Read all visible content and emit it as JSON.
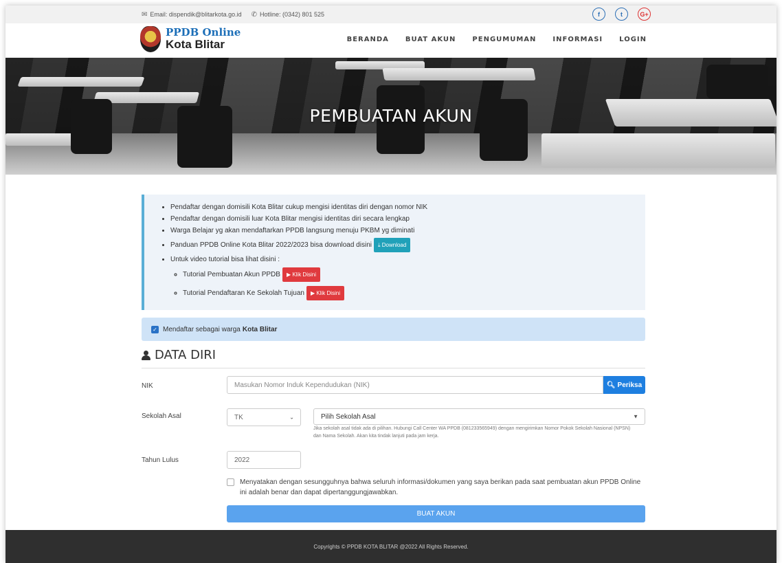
{
  "topbar": {
    "email": "Email: dispendik@blitarkota.go.id",
    "hotline": "Hotline: (0342) 801 525",
    "social": {
      "facebook": "f",
      "twitter": "t",
      "gplus": "G+"
    }
  },
  "brand": {
    "line1": "PPDB Online",
    "line2": "Kota Blitar"
  },
  "nav": {
    "beranda": "BERANDA",
    "buat_akun": "BUAT AKUN",
    "pengumuman": "PENGUMUMAN",
    "informasi": "INFORMASI",
    "login": "LOGIN"
  },
  "hero": {
    "title": "PEMBUATAN AKUN"
  },
  "info": {
    "items": [
      "Pendaftar dengan domisili Kota Blitar cukup mengisi identitas diri dengan nomor NIK",
      "Pendaftar dengan domisili luar Kota Blitar mengisi identitas diri secara lengkap",
      "Warga Belajar yg akan mendaftarkan PPDB langsung menuju PKBM yg diminati",
      "Panduan PPDB Online Kota Blitar 2022/2023 bisa download disini",
      "Untuk video tutorial bisa lihat disini :"
    ],
    "download_label": "Download",
    "sub_items": [
      "Tutorial Pembuatan Akun PPDB",
      "Tutorial Pendaftaran Ke Sekolah Tujuan"
    ],
    "klik_label": "Klik Disini"
  },
  "banner": {
    "text": "Mendaftar sebagai warga",
    "bold": "Kota Blitar"
  },
  "section": {
    "title": "DATA DIRI"
  },
  "form": {
    "nik_label": "NIK",
    "nik_placeholder": "Masukan Nomor Induk Kependudukan (NIK)",
    "periksa_label": "Periksa",
    "sekolah_label": "Sekolah Asal",
    "jenjang_value": "TK",
    "sekolah_value": "Pilih Sekolah Asal",
    "help_text": "Jika sekolah asal tidak ada di pilihan. Hubungi Call Center WA PPDB (081233565949) dengan mengirimkan Nomor Pokok Sekolah Nasional (NPSN) dan Nama Sekolah. Akan kita tindak lanjuti pada jam kerja.",
    "tahun_label": "Tahun Lulus",
    "tahun_value": "2022",
    "agree_text": "Menyatakan dengan sesungguhnya bahwa seluruh informasi/dokumen yang saya berikan pada saat pembuatan akun PPDB Online ini adalah benar dan dapat dipertanggungjawabkan.",
    "submit_label": "BUAT AKUN"
  },
  "footer": {
    "text": "Copyrights © PPDB KOTA BLITAR @2022 All Rights Reserved."
  },
  "colors": {
    "primary": "#1e7fe0",
    "teal": "#20a1b9",
    "red": "#e03a3e",
    "footer": "#2f2f2f"
  }
}
